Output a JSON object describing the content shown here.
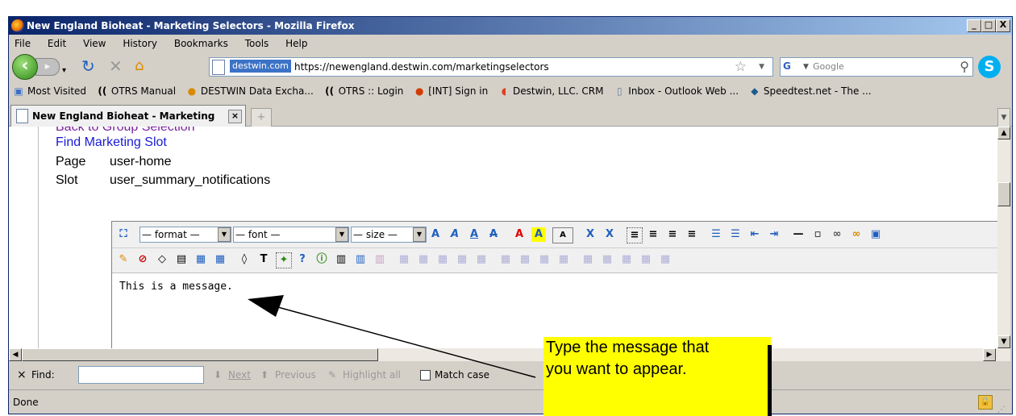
{
  "window": {
    "title": "New England Bioheat - Marketing Selectors - Mozilla Firefox",
    "minimize": "_",
    "maximize": "□",
    "close": "X"
  },
  "menu": [
    "File",
    "Edit",
    "View",
    "History",
    "Bookmarks",
    "Tools",
    "Help"
  ],
  "navbar": {
    "domain": "destwin.com",
    "url": "https://newengland.destwin.com/marketingselectors",
    "search_placeholder": "Google"
  },
  "bookmarks": [
    {
      "icon": "most-visited-icon",
      "label": "Most Visited"
    },
    {
      "icon": "otrs-icon",
      "label": "OTRS Manual"
    },
    {
      "icon": "destwin-icon",
      "label": "DESTWIN Data Excha..."
    },
    {
      "icon": "otrs-icon",
      "label": "OTRS :: Login"
    },
    {
      "icon": "int-icon",
      "label": "[INT] Sign in"
    },
    {
      "icon": "crm-icon",
      "label": "Destwin, LLC. CRM"
    },
    {
      "icon": "page-icon",
      "label": "Inbox - Outlook Web ..."
    },
    {
      "icon": "speedtest-icon",
      "label": "Speedtest.net - The ..."
    }
  ],
  "tab": {
    "label": "New England Bioheat - Marketing Sel..."
  },
  "page": {
    "back_link": "Back to Group Selection",
    "find_link": "Find Marketing Slot",
    "page_label": "Page",
    "page_value": "user-home",
    "slot_label": "Slot",
    "slot_value": "user_summary_notifications"
  },
  "editor": {
    "format_select": "— format —",
    "font_select": "— font —",
    "size_select": "— size —",
    "content": "This is a message."
  },
  "findbar": {
    "close": "×",
    "label": "Find:",
    "value": "",
    "next": "Next",
    "previous": "Previous",
    "highlight": "Highlight all",
    "match_case": "Match case"
  },
  "status": {
    "text": "Done"
  },
  "callout": {
    "line1": "Type the message that",
    "line2": "you want to appear."
  },
  "colors": {
    "title_start": "#0a246a",
    "title_end": "#a6caf0",
    "visited_link": "#7b1fa2",
    "link": "#1a1ad6",
    "callout": "#ffff00"
  }
}
